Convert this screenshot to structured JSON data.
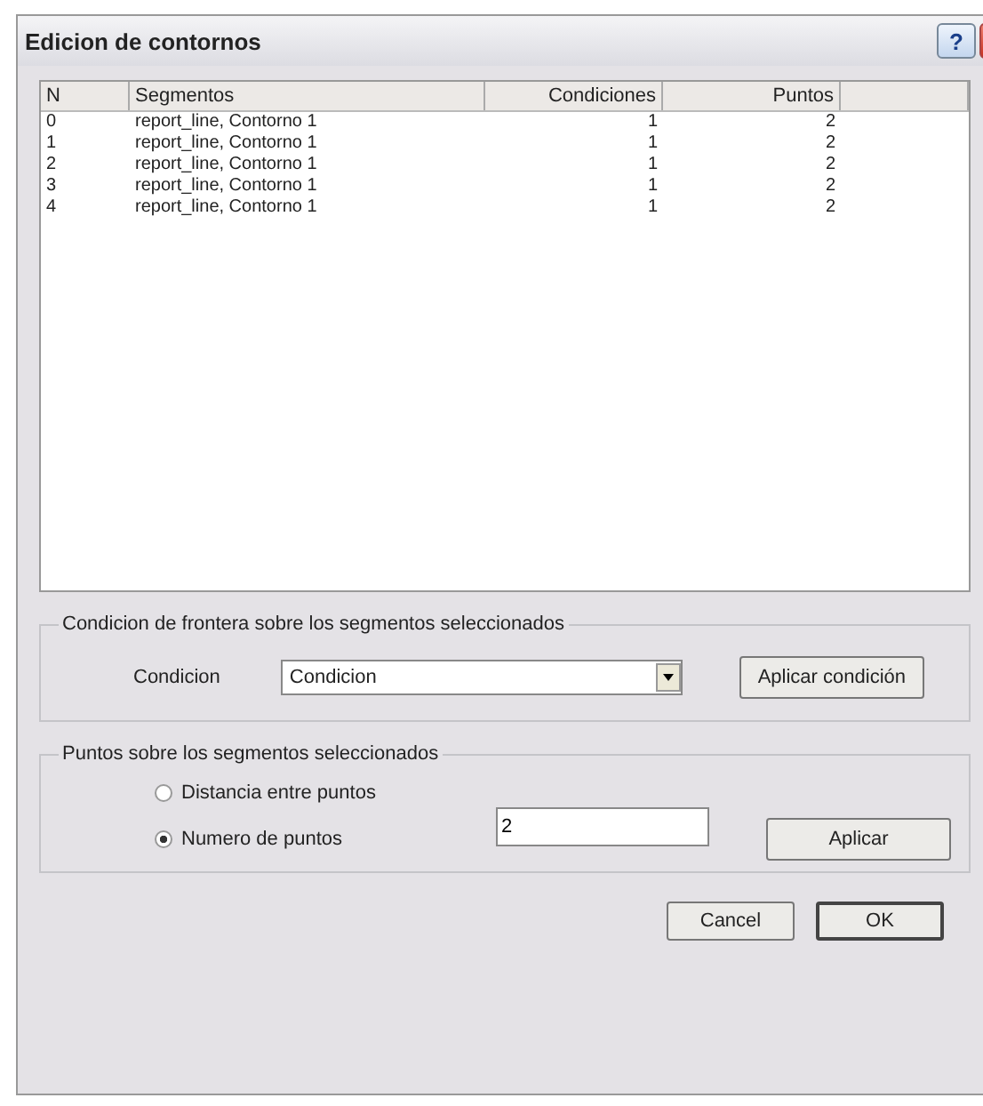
{
  "window": {
    "title": "Edicion de contornos",
    "help_button": "?"
  },
  "table": {
    "columns": [
      "N",
      "Segmentos",
      "Condiciones",
      "Puntos"
    ],
    "rows": [
      {
        "n": "0",
        "segment": "report_line, Contorno 1",
        "conditions": "1",
        "points": "2"
      },
      {
        "n": "1",
        "segment": "report_line, Contorno 1",
        "conditions": "1",
        "points": "2"
      },
      {
        "n": "2",
        "segment": "report_line, Contorno 1",
        "conditions": "1",
        "points": "2"
      },
      {
        "n": "3",
        "segment": "report_line, Contorno 1",
        "conditions": "1",
        "points": "2"
      },
      {
        "n": "4",
        "segment": "report_line, Contorno 1",
        "conditions": "1",
        "points": "2"
      }
    ]
  },
  "condition_group": {
    "title": "Condicion de frontera sobre los segmentos seleccionados",
    "label": "Condicion",
    "dropdown_value": "Condicion",
    "button": "Aplicar condición"
  },
  "points_group": {
    "title": "Puntos sobre los segmentos seleccionados",
    "options": [
      {
        "label": "Distancia entre puntos",
        "selected": false
      },
      {
        "label": "Numero de puntos",
        "selected": true
      }
    ],
    "field_value": "2",
    "button": "Aplicar"
  },
  "buttons": [
    {
      "label": "Cancel",
      "kind": "normal"
    },
    {
      "label": "OK",
      "kind": "default"
    }
  ]
}
